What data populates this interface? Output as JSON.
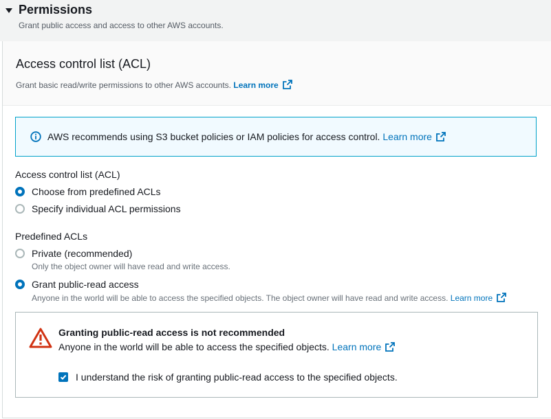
{
  "section": {
    "title": "Permissions",
    "subtitle": "Grant public access and access to other AWS accounts."
  },
  "acl_panel": {
    "title": "Access control list (ACL)",
    "description": "Grant basic read/write permissions to other AWS accounts.",
    "learn_more": "Learn more"
  },
  "info_alert": {
    "text": "AWS recommends using S3 bucket policies or IAM policies for access control.",
    "learn_more": "Learn more",
    "icon": "info-icon"
  },
  "acl_mode": {
    "label": "Access control list (ACL)",
    "options": [
      {
        "label": "Choose from predefined ACLs",
        "selected": true
      },
      {
        "label": "Specify individual ACL permissions",
        "selected": false
      }
    ]
  },
  "predefined_acls": {
    "label": "Predefined ACLs",
    "options": [
      {
        "label": "Private (recommended)",
        "description": "Only the object owner will have read and write access.",
        "selected": false
      },
      {
        "label": "Grant public-read access",
        "description": "Anyone in the world will be able to access the specified objects. The object owner will have read and write access.",
        "learn_more": "Learn more",
        "selected": true
      }
    ]
  },
  "warning": {
    "title": "Granting public-read access is not recommended",
    "text": "Anyone in the world will be able to access the specified objects.",
    "learn_more": "Learn more",
    "icon": "warning-icon",
    "checkbox_label": "I understand the risk of granting public-read access to the specified objects.",
    "checkbox_checked": true
  },
  "colors": {
    "link": "#0073bb",
    "info_border": "#00a1c9",
    "info_bg": "#f1faff",
    "warning": "#d13212"
  }
}
